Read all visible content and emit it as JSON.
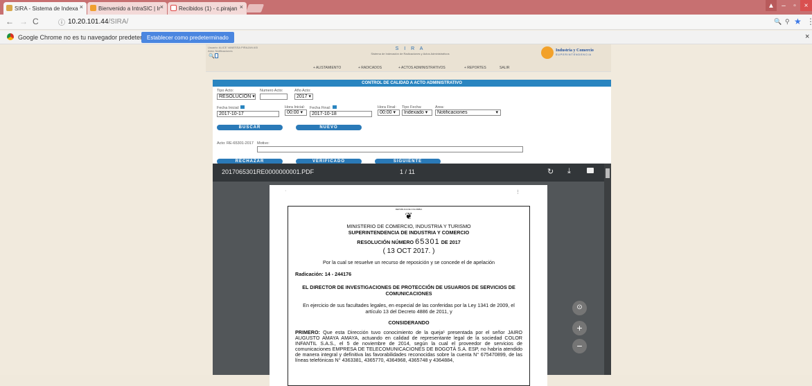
{
  "browser": {
    "tabs": [
      {
        "label": "SIRA - Sistema de Indexa"
      },
      {
        "label": "Bienvenido a IntraSIC | Ir"
      },
      {
        "label": "Recibidos (1) - c.pirajan"
      }
    ],
    "url_domain": "10.20.101.44",
    "url_path": "/SIRA/",
    "infobar_text": "Google Chrome no es tu navegador predeterminado.",
    "infobar_button": "Establecer como predeterminado"
  },
  "header": {
    "user_line": "Usuario: ALICE VANESSA PIRAJAN ASI",
    "area_line": "Area: Notificaciones",
    "app_name": "S I R A",
    "app_sub": "Sistema de Indexación de Radicaciones y Actos Administrativos",
    "logo_line1": "Industria y Comercio",
    "logo_line2": "SUPERINTENDENCIA"
  },
  "menu": [
    "+ ALISTAMIENTO",
    "+ RADICADOS",
    "+ ACTOS ADMINISTRATIVOS",
    "+ REPORTES",
    "SALIR"
  ],
  "form": {
    "title": "CONTROL DE CALIDAD A ACTO ADMINISTRATIVO",
    "tipo_acto_label": "Tipo Acto:",
    "tipo_acto_value": "RESOLUCION",
    "numero_label": "Numero Acto:",
    "anio_label": "Año Acto:",
    "anio_value": "2017",
    "fecha_inicial_label": "Fecha Inicial:",
    "fecha_inicial_value": "2017-10-17",
    "hora_inicial_label": "Hora Inicial:",
    "hora_inicial_value": "00:00",
    "fecha_final_label": "Fecha Final:",
    "fecha_final_value": "2017-10-18",
    "hora_final_label": "Hora Final:",
    "hora_final_value": "00:00",
    "tipo_fecha_label": "Tipo Fecha:",
    "tipo_fecha_value": "Indexado",
    "area_label": "Area:",
    "area_value": "Notificaciones",
    "buscar": "BUSCAR",
    "nuevo": "NUEVO",
    "acto_line": "Acto: RE-65301-2017",
    "motivo_label": "Motivo:",
    "rechazar": "RECHAZAR",
    "verificado": "VERIFICADO",
    "siguiente": "SIGUIENTE"
  },
  "viewer": {
    "filename": "2017065301RE0000000001.PDF",
    "page_current": "1",
    "page_sep": "/",
    "page_total": "11"
  },
  "doc": {
    "republica": "REPUBLICA DE COLOMBIA",
    "ministerio": "MINISTERIO DE COMERCIO, INDUSTRIA Y TURISMO",
    "super": "SUPERINTENDENCIA DE INDUSTRIA Y COMERCIO",
    "resolucion": "RESOLUCIÓN NÚMERO",
    "numero": "65301",
    "de": "DE 2017",
    "fecha": "( 13 OCT 2017. )",
    "por": "Por la cual se resuelve un recurso de reposición y se concede el de apelación",
    "radicacion": "Radicación: 14 - 244176",
    "director": "EL DIRECTOR DE INVESTIGACIONES DE PROTECCIÓN DE USUARIOS DE SERVICIOS DE COMUNICACIONES",
    "ejercicio": "En ejercicio de sus facultades legales, en especial de las conferidas por la Ley 1341 de 2009, el artículo 13 del Decreto 4886 de 2011, y",
    "considerando": "CONSIDERANDO",
    "primero_label": "PRIMERO:",
    "primero_text": "Que esta Dirección tuvo conocimiento de la queja¹ presentada por el señor JAIRO AUGUSTO AMAYA AMAYA, actuando en calidad de representante legal de la sociedad COLOR INFANTIL S.A.S., el 5 de noviembre de 2014, según la cual el proveedor de servicios de comunicaciones EMPRESA DE TELECOMUNICACIONES DE BOGOTÁ S.A. ESP, no habría atendido de manera integral y definitiva las favorabilidades reconocidas sobre la cuenta N° 675470899, de las líneas telefónicas N° 4363381, 4365770, 4364968, 4365748 y 4364884,"
  }
}
